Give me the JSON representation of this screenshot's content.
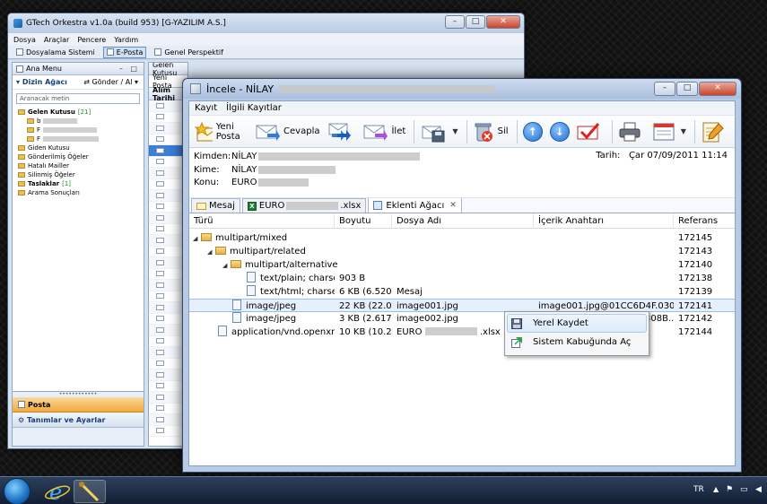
{
  "bg_window": {
    "title": "GTech Orkestra v1.0a (build 953) [G-YAZILIM A.S.]",
    "menu": [
      "Dosya",
      "Araçlar",
      "Pencere",
      "Yardım"
    ],
    "perspectives": [
      "Dosyalama Sistemi",
      "E-Posta",
      "Genel Perspektif"
    ],
    "left_header": "Ana Menu",
    "tree_title": "Dizin Ağacı",
    "send_receive": "Gönder / Al",
    "search_placeholder": "Aranacak metin",
    "inbox": {
      "label": "Gelen Kutusu",
      "count": "[21]"
    },
    "inbox_children": [
      "b",
      "F",
      "F"
    ],
    "folders": [
      "Giden Kutusu",
      "Gönderilmiş Öğeler",
      "Hatalı Mailler",
      "Silinmiş Öğeler"
    ],
    "drafts": {
      "label": "Taslaklar",
      "count": "[1]"
    },
    "search_results": "Arama Sonuçları",
    "nav_posta": "Posta",
    "nav_settings": "Tanımlar ve Ayarlar",
    "mid_header": "Gelen Kutusu",
    "mid_new": "Yeni Posta",
    "mid_col": "Alım Tarihi"
  },
  "dialog": {
    "title": "İncele - NİLAY",
    "menu": [
      "Kayıt",
      "İlgili Kayıtlar"
    ],
    "toolbar": {
      "new_mail": "Yeni Posta",
      "reply": "Cevapla",
      "forward": "İlet",
      "delete": "Sil"
    },
    "header": {
      "from_label": "Kimden:",
      "from_value": "NİLAY",
      "to_label": "Kime:",
      "to_value": "NİLAY",
      "subject_label": "Konu:",
      "subject_value": "EURO",
      "date_label": "Tarih:",
      "date_value": "Çar 07/09/2011 11:14"
    },
    "tabs": [
      {
        "label": "Mesaj"
      },
      {
        "label": "EURO",
        "suffix": ".xlsx"
      },
      {
        "label": "Eklenti Ağacı"
      }
    ],
    "columns": [
      "Türü",
      "Boyutu",
      "Dosya Adı",
      "İçerik Anahtarı",
      "Referans"
    ],
    "rows": [
      {
        "type": "multipart/mixed",
        "size": "",
        "name": "",
        "key": "",
        "ref": "172145"
      },
      {
        "type": "multipart/related",
        "size": "",
        "name": "",
        "key": "",
        "ref": "172143"
      },
      {
        "type": "multipart/alternative",
        "size": "",
        "name": "",
        "key": "",
        "ref": "172140"
      },
      {
        "type": "text/plain; charse",
        "size": "903 B",
        "name": "",
        "key": "",
        "ref": "172138"
      },
      {
        "type": "text/html; charse",
        "size": "6 KB (6.520)",
        "name": "Mesaj",
        "key": "",
        "ref": "172139"
      },
      {
        "type": "image/jpeg",
        "size": "22 KB (22.0...",
        "name": "image001.jpg",
        "key": "image001.jpg@01CC6D4F.0308B...",
        "ref": "172141"
      },
      {
        "type": "image/jpeg",
        "size": "3 KB (2.617)",
        "name": "image002.jpg",
        "key": "308B...",
        "ref": "172142"
      },
      {
        "type": "application/vnd.openxm",
        "size": "10 KB (10.2...",
        "name": "EURO",
        "name_suffix": ".xlsx",
        "key": "",
        "ref": "172144"
      }
    ],
    "context_menu": [
      "Yerel Kaydet",
      "Sistem Kabuğunda Aç"
    ]
  },
  "taskbar": {
    "lang": "TR",
    "clock": ""
  }
}
